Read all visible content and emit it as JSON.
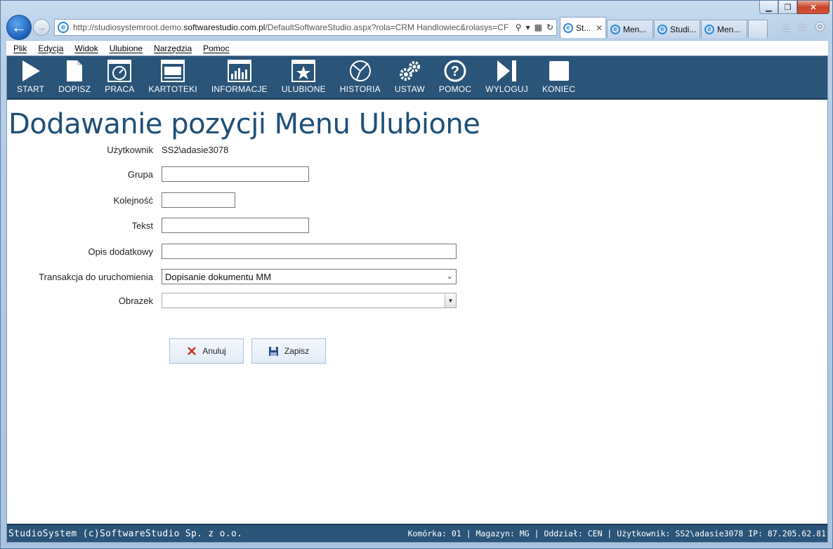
{
  "browser": {
    "url_prefix": "http://studiosystemroot.demo.",
    "url_domain": "softwarestudio.com.pl",
    "url_suffix": "/DefaultSoftwareStudio.aspx?rola=CRM Handlowiec&rolasys=CF",
    "tabs": [
      {
        "label": "St...",
        "active": true
      },
      {
        "label": "Men...",
        "active": false
      },
      {
        "label": "Studi...",
        "active": false
      },
      {
        "label": "Men...",
        "active": false
      }
    ],
    "menu": [
      "Plik",
      "Edycja",
      "Widok",
      "Ulubione",
      "Narzędzia",
      "Pomoc"
    ]
  },
  "toolbar": {
    "items": [
      {
        "label": "START",
        "icon": "play-icon"
      },
      {
        "label": "DOPISZ",
        "icon": "document-icon"
      },
      {
        "label": "PRACA",
        "icon": "gauge-icon"
      },
      {
        "label": "KARTOTEKI",
        "icon": "window-icon"
      },
      {
        "label": "INFORMACJE",
        "icon": "bar-chart-icon"
      },
      {
        "label": "ULUBIONE",
        "icon": "star-icon"
      },
      {
        "label": "HISTORIA",
        "icon": "history-icon"
      },
      {
        "label": "USTAW",
        "icon": "gears-icon"
      },
      {
        "label": "POMOC",
        "icon": "help-icon"
      },
      {
        "label": "WYLOGUJ",
        "icon": "logout-icon"
      },
      {
        "label": "KONIEC",
        "icon": "stop-icon"
      }
    ]
  },
  "page": {
    "title": "Dodawanie pozycji Menu Ulubione"
  },
  "form": {
    "user_label": "Użytkownik",
    "user_value": "SS2\\adasie3078",
    "group_label": "Grupa",
    "group_value": "",
    "order_label": "Kolejność",
    "order_value": "",
    "text_label": "Tekst",
    "text_value": "",
    "desc_label": "Opis dodatkowy",
    "desc_value": "",
    "transaction_label": "Transakcja do uruchomienia",
    "transaction_value": "Dopisanie dokumentu MM",
    "image_label": "Obrazek",
    "image_value": "",
    "cancel_label": "Anuluj",
    "save_label": "Zapisz"
  },
  "footer": {
    "left": "StudioSystem (c)SoftwareStudio Sp. z o.o.",
    "right": "Komórka: 01 | Magazyn: MG | Oddział: CEN | Użytkownik: SS2\\adasie3078 IP: 87.205.62.81"
  }
}
